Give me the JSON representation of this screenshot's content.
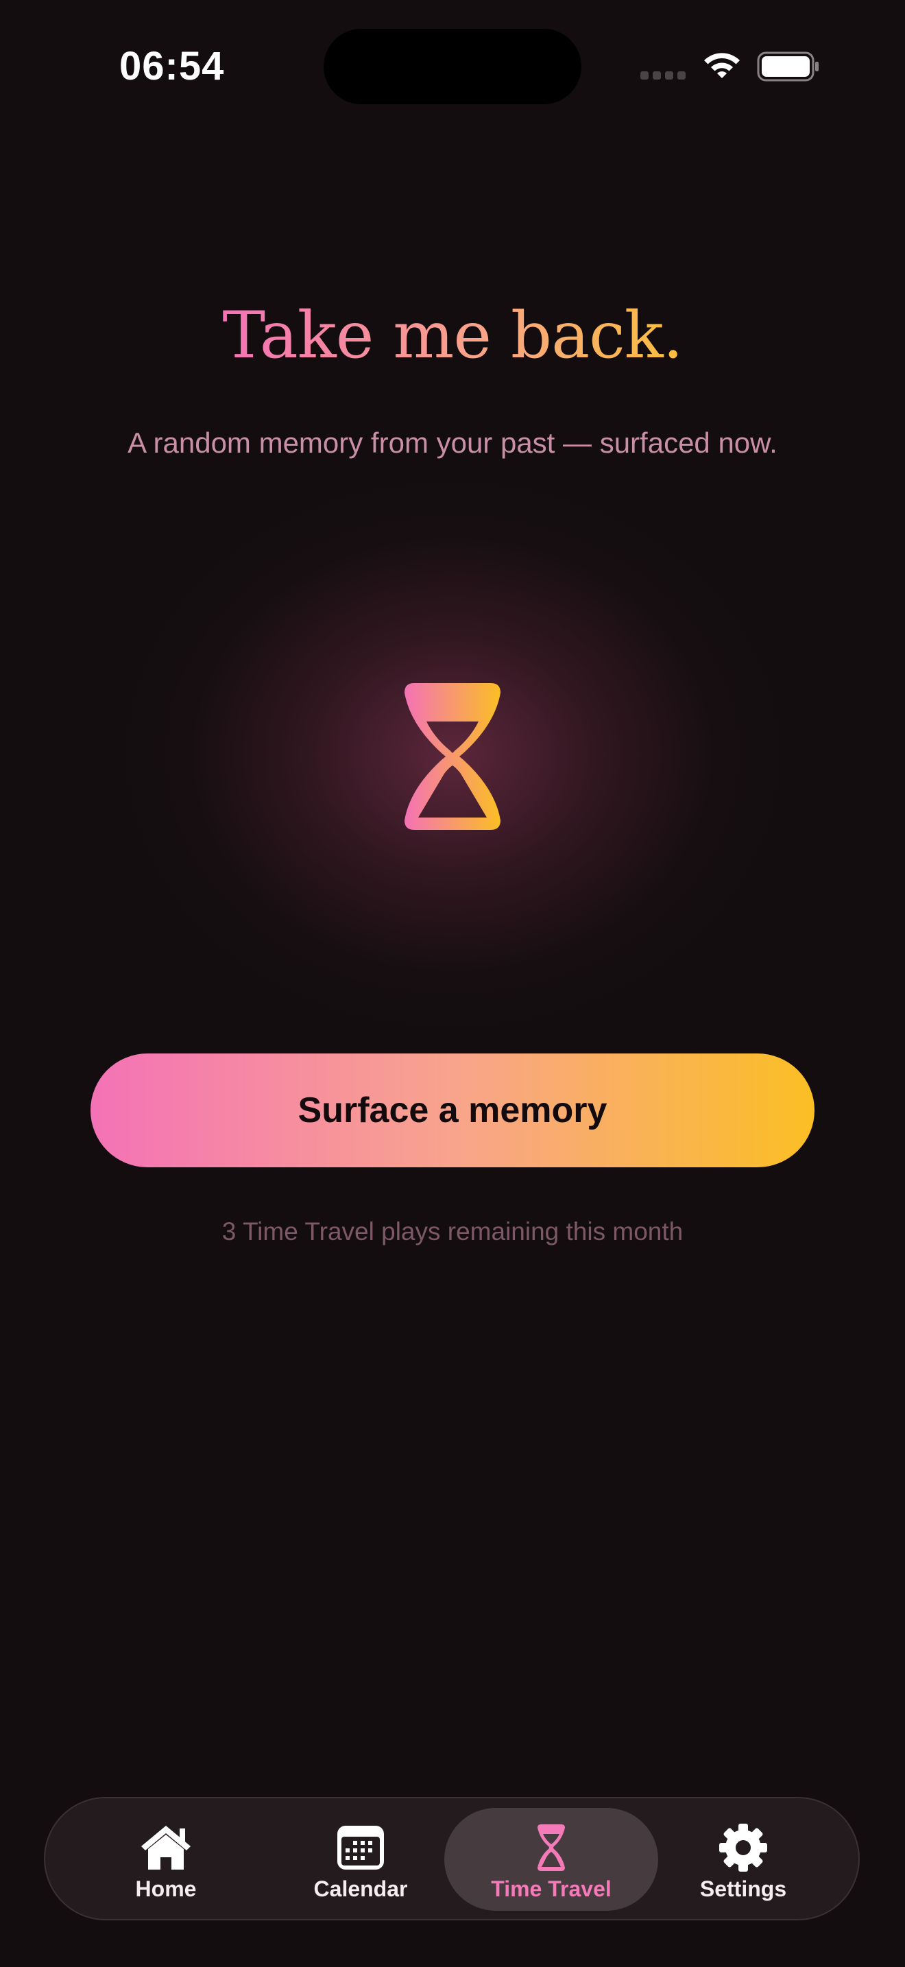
{
  "status_bar": {
    "time": "06:54"
  },
  "main": {
    "title": "Take me back.",
    "subtitle": "A random memory from your past — surfaced now.",
    "hero_icon": "hourglass-icon",
    "cta_label": "Surface a memory",
    "remaining_text": "3 Time Travel plays remaining this month"
  },
  "colors": {
    "background": "#130d0f",
    "accent_pink": "#f472b6",
    "accent_peach": "#f8a48d",
    "accent_amber": "#fbbf24",
    "subtitle": "#c98fa6",
    "muted": "#7d5867",
    "tabbar": "#231b1e",
    "active_tab": "#463c40"
  },
  "tabs": [
    {
      "label": "Home",
      "icon": "house-icon",
      "active": false
    },
    {
      "label": "Calendar",
      "icon": "calendar-icon",
      "active": false
    },
    {
      "label": "Time Travel",
      "icon": "hourglass-icon",
      "active": true
    },
    {
      "label": "Settings",
      "icon": "gear-icon",
      "active": false
    }
  ]
}
